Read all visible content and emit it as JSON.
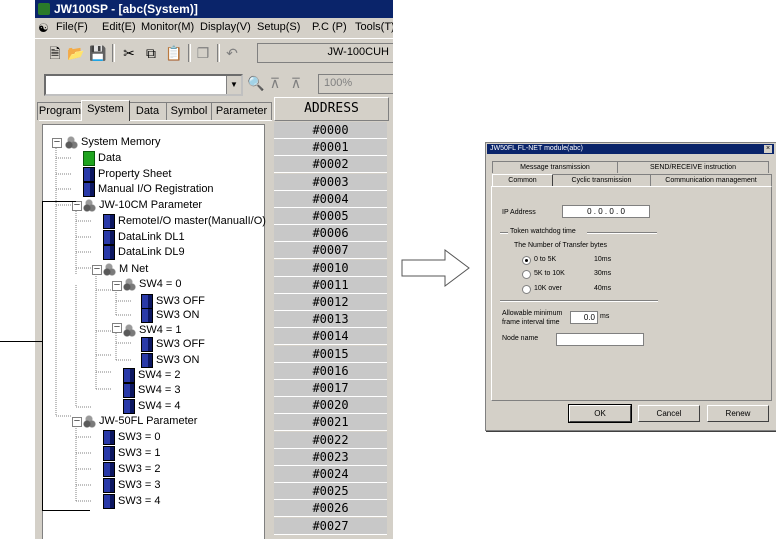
{
  "app": {
    "title": "JW100SP - [abc(System)]",
    "menu": [
      "File(F)",
      "Edit(E)",
      "Monitor(M)",
      "Display(V)",
      "Setup(S)",
      "P.C (P)",
      "Tools(T)"
    ],
    "plc_model": "JW-100CUH",
    "zoom": "100%",
    "tabs": [
      "Program",
      "System",
      "Data",
      "Symbol",
      "Parameter"
    ],
    "active_tab": "System",
    "tree": [
      {
        "label": "System Memory",
        "icon": "memory-icon"
      },
      {
        "label": "Data",
        "icon": "data-icon"
      },
      {
        "label": "Property Sheet",
        "icon": "document-icon"
      },
      {
        "label": "Manual I/O Registration",
        "icon": "document-icon"
      },
      {
        "label": "JW-10CM Parameter",
        "icon": "memory-icon"
      },
      {
        "label": "RemoteI/O master(ManualI/O)",
        "icon": "document-icon"
      },
      {
        "label": "DataLink DL1",
        "icon": "document-icon"
      },
      {
        "label": "DataLink DL9",
        "icon": "document-icon"
      },
      {
        "label": "M Net",
        "icon": "memory-icon"
      },
      {
        "label": "SW4 = 0",
        "icon": "memory-icon"
      },
      {
        "label": "SW3 OFF",
        "icon": "document-icon"
      },
      {
        "label": "SW3 ON",
        "icon": "document-icon"
      },
      {
        "label": "SW4 = 1",
        "icon": "memory-icon"
      },
      {
        "label": "SW3 OFF",
        "icon": "document-icon"
      },
      {
        "label": "SW3 ON",
        "icon": "document-icon"
      },
      {
        "label": "SW4 = 2",
        "icon": "document-icon"
      },
      {
        "label": "SW4 = 3",
        "icon": "document-icon"
      },
      {
        "label": "SW4 = 4",
        "icon": "document-icon"
      },
      {
        "label": "JW-50FL Parameter",
        "icon": "memory-icon"
      },
      {
        "label": "SW3 = 0",
        "icon": "document-icon"
      },
      {
        "label": "SW3 = 1",
        "icon": "document-icon"
      },
      {
        "label": "SW3 = 2",
        "icon": "document-icon"
      },
      {
        "label": "SW3 = 3",
        "icon": "document-icon"
      },
      {
        "label": "SW3 = 4",
        "icon": "document-icon"
      }
    ],
    "address_header": "ADDRESS",
    "addresses": [
      "#0000",
      "#0001",
      "#0002",
      "#0003",
      "#0004",
      "#0005",
      "#0006",
      "#0007",
      "#0010",
      "#0011",
      "#0012",
      "#0013",
      "#0014",
      "#0015",
      "#0016",
      "#0017",
      "#0020",
      "#0021",
      "#0022",
      "#0023",
      "#0024",
      "#0025",
      "#0026",
      "#0027"
    ]
  },
  "dialog": {
    "title": "JW50FL FL-NET module(abc)",
    "tabs_back": [
      "Message transmission",
      "SEND/RECEIVE instruction"
    ],
    "tabs_front": [
      "Common",
      "Cyclic transmission",
      "Communication management"
    ],
    "active_tab": "Common",
    "ip_label": "IP Address",
    "ip_value": "0 . 0 . 0 . 0",
    "token_group": "Token watchdog time",
    "transfer_label": "The Number of Transfer bytes",
    "radio_options": [
      {
        "label": "0 to 5K",
        "value": "10ms",
        "selected": true
      },
      {
        "label": "5K to 10K",
        "value": "30ms",
        "selected": false
      },
      {
        "label": "10K over",
        "value": "40ms",
        "selected": false
      }
    ],
    "allowable_label_1": "Allowable minimum",
    "allowable_label_2": "frame interval time",
    "allowable_value": "0.0",
    "allowable_unit": "ms",
    "node_name_label": "Node name",
    "node_name_value": "",
    "buttons": {
      "ok": "OK",
      "cancel": "Cancel",
      "renew": "Renew"
    }
  },
  "colors": {
    "titlebar": "#0a246a",
    "face": "#d4d0c8",
    "address_cell": "#c8c8c8"
  }
}
